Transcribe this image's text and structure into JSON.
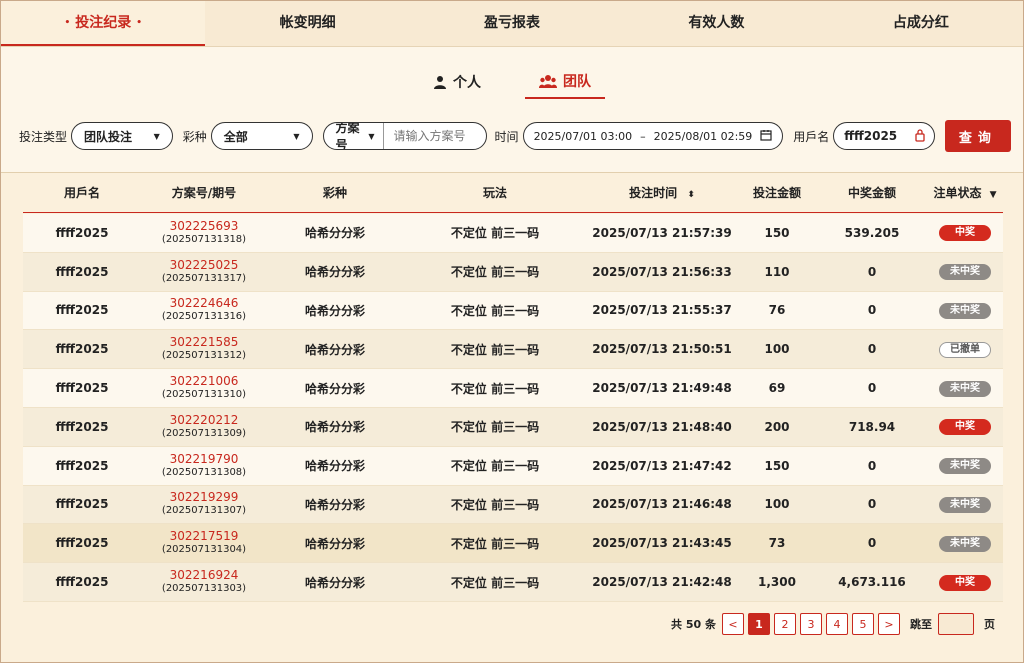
{
  "tabs": [
    {
      "label": "投注纪录",
      "active": true
    },
    {
      "label": "帐变明细",
      "active": false
    },
    {
      "label": "盈亏报表",
      "active": false
    },
    {
      "label": "有效人数",
      "active": false
    },
    {
      "label": "占成分红",
      "active": false
    }
  ],
  "subtabs": {
    "personal": "个人",
    "team": "团队"
  },
  "filters": {
    "bet_type_label": "投注类型",
    "bet_type_value": "团队投注",
    "lottery_label": "彩种",
    "lottery_value": "全部",
    "plan_select": "方案号",
    "plan_placeholder": "请输入方案号",
    "time_label": "时间",
    "date_start": "2025/07/01 03:00",
    "date_sep": "–",
    "date_end": "2025/08/01 02:59",
    "username_label": "用戶名",
    "username_value": "ffff2025",
    "query_button": "查询"
  },
  "table": {
    "headers": [
      "用戶名",
      "方案号/期号",
      "彩种",
      "玩法",
      "投注时间",
      "投注金额",
      "中奖金额",
      "注单状态"
    ],
    "rows": [
      {
        "user": "ffff2025",
        "plan": "302225693",
        "issue": "(202507131318)",
        "lottery": "哈希分分彩",
        "play": "不定位 前三一码",
        "time": "2025/07/13 21:57:39",
        "bet": "150",
        "win": "539.205",
        "status": "中奖",
        "status_type": "win"
      },
      {
        "user": "ffff2025",
        "plan": "302225025",
        "issue": "(202507131317)",
        "lottery": "哈希分分彩",
        "play": "不定位 前三一码",
        "time": "2025/07/13 21:56:33",
        "bet": "110",
        "win": "0",
        "status": "未中奖",
        "status_type": "lose"
      },
      {
        "user": "ffff2025",
        "plan": "302224646",
        "issue": "(202507131316)",
        "lottery": "哈希分分彩",
        "play": "不定位 前三一码",
        "time": "2025/07/13 21:55:37",
        "bet": "76",
        "win": "0",
        "status": "未中奖",
        "status_type": "lose"
      },
      {
        "user": "ffff2025",
        "plan": "302221585",
        "issue": "(202507131312)",
        "lottery": "哈希分分彩",
        "play": "不定位 前三一码",
        "time": "2025/07/13 21:50:51",
        "bet": "100",
        "win": "0",
        "status": "已撤单",
        "status_type": "cancel"
      },
      {
        "user": "ffff2025",
        "plan": "302221006",
        "issue": "(202507131310)",
        "lottery": "哈希分分彩",
        "play": "不定位 前三一码",
        "time": "2025/07/13 21:49:48",
        "bet": "69",
        "win": "0",
        "status": "未中奖",
        "status_type": "lose"
      },
      {
        "user": "ffff2025",
        "plan": "302220212",
        "issue": "(202507131309)",
        "lottery": "哈希分分彩",
        "play": "不定位 前三一码",
        "time": "2025/07/13 21:48:40",
        "bet": "200",
        "win": "718.94",
        "status": "中奖",
        "status_type": "win"
      },
      {
        "user": "ffff2025",
        "plan": "302219790",
        "issue": "(202507131308)",
        "lottery": "哈希分分彩",
        "play": "不定位 前三一码",
        "time": "2025/07/13 21:47:42",
        "bet": "150",
        "win": "0",
        "status": "未中奖",
        "status_type": "lose"
      },
      {
        "user": "ffff2025",
        "plan": "302219299",
        "issue": "(202507131307)",
        "lottery": "哈希分分彩",
        "play": "不定位 前三一码",
        "time": "2025/07/13 21:46:48",
        "bet": "100",
        "win": "0",
        "status": "未中奖",
        "status_type": "lose"
      },
      {
        "user": "ffff2025",
        "plan": "302217519",
        "issue": "(202507131304)",
        "lottery": "哈希分分彩",
        "play": "不定位 前三一码",
        "time": "2025/07/13 21:43:45",
        "bet": "73",
        "win": "0",
        "status": "未中奖",
        "status_type": "lose"
      },
      {
        "user": "ffff2025",
        "plan": "302216924",
        "issue": "(202507131303)",
        "lottery": "哈希分分彩",
        "play": "不定位 前三一码",
        "time": "2025/07/13 21:42:48",
        "bet": "1,300",
        "win": "4,673.116",
        "status": "中奖",
        "status_type": "win"
      }
    ]
  },
  "pagination": {
    "total_text": "共 50 条",
    "prev": "<",
    "next": ">",
    "pages": [
      "1",
      "2",
      "3",
      "4",
      "5"
    ],
    "current": "1",
    "jump_label": "跳至",
    "page_suffix": "页"
  },
  "colors": {
    "accent": "#c8281e",
    "background": "#fdf6e9",
    "lose": "#8e8a86"
  },
  "icons": {
    "personal": "person-icon",
    "team": "team-icon",
    "calendar": "calendar-icon",
    "clear": "clear-icon",
    "sort": "sort-icon",
    "filter": "filter-icon"
  }
}
